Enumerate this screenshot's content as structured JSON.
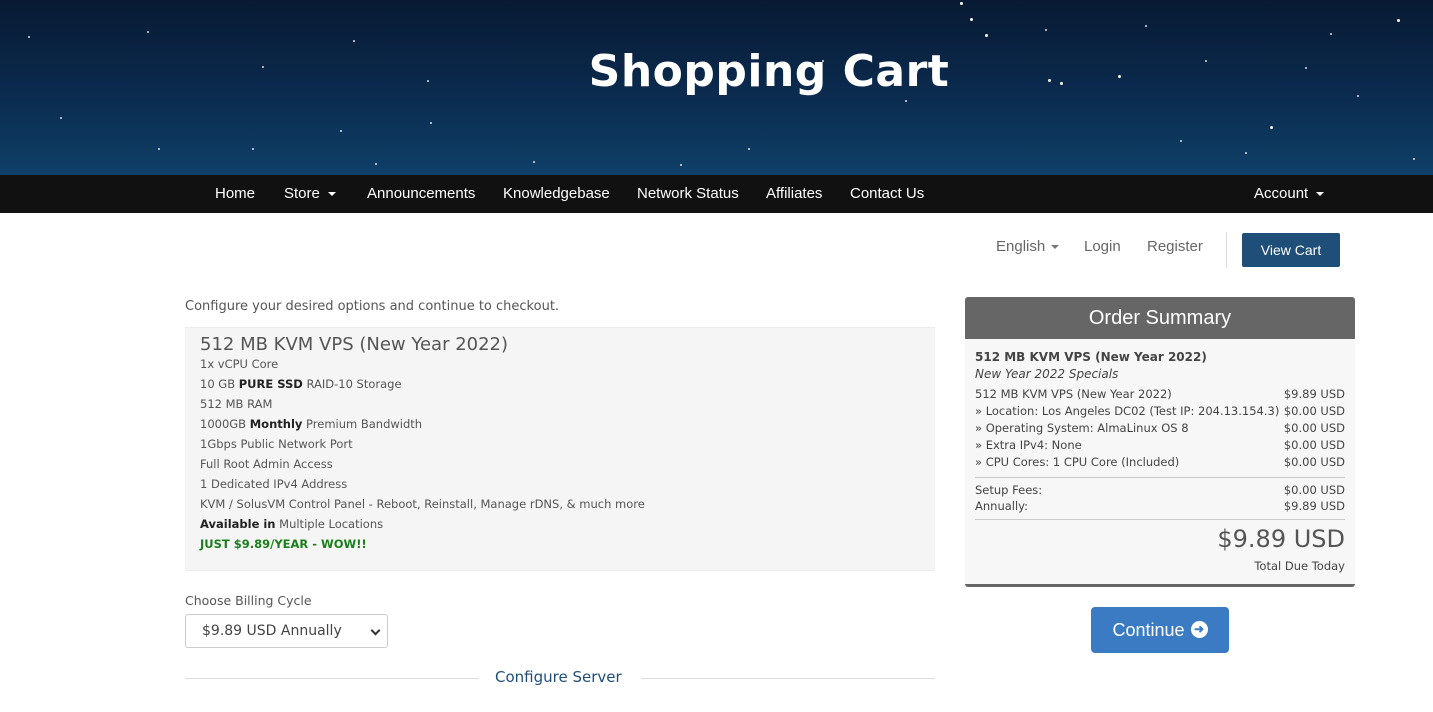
{
  "hero": {
    "title": "Shopping Cart"
  },
  "nav": {
    "home": "Home",
    "store": "Store",
    "announcements": "Announcements",
    "knowledgebase": "Knowledgebase",
    "network_status": "Network Status",
    "affiliates": "Affiliates",
    "contact": "Contact Us",
    "account": "Account"
  },
  "util": {
    "language": "English",
    "login": "Login",
    "register": "Register",
    "view_cart": "View Cart"
  },
  "main": {
    "intro": "Configure your desired options and continue to checkout.",
    "product": {
      "name": "512 MB KVM VPS (New Year 2022)",
      "features": [
        {
          "pre": "1x vCPU Core",
          "bold": "",
          "post": ""
        },
        {
          "pre": "10 GB ",
          "bold": "PURE SSD",
          "post": " RAID-10 Storage"
        },
        {
          "pre": "512 MB RAM",
          "bold": "",
          "post": ""
        },
        {
          "pre": "1000GB ",
          "bold": "Monthly",
          "post": " Premium Bandwidth"
        },
        {
          "pre": "1Gbps Public Network Port",
          "bold": "",
          "post": ""
        },
        {
          "pre": "Full Root Admin Access",
          "bold": "",
          "post": ""
        },
        {
          "pre": "1 Dedicated IPv4 Address",
          "bold": "",
          "post": ""
        },
        {
          "pre": "KVM / SolusVM Control Panel - Reboot, Reinstall, Manage rDNS, & much more",
          "bold": "",
          "post": ""
        },
        {
          "pre": "",
          "bold": "Available in",
          "post": " Multiple Locations"
        }
      ],
      "promo": "JUST $9.89/YEAR - WOW!!"
    },
    "billing": {
      "label": "Choose Billing Cycle",
      "selected": "$9.89 USD Annually"
    },
    "configure_title": "Configure Server"
  },
  "summary": {
    "title": "Order Summary",
    "product_name": "512 MB KVM VPS (New Year 2022)",
    "group": "New Year 2022 Specials",
    "lines": [
      {
        "label": "512 MB KVM VPS (New Year 2022)",
        "amount": "$9.89 USD"
      },
      {
        "label": "» Location: Los Angeles DC02 (Test IP: 204.13.154.3)",
        "amount": "$0.00 USD"
      },
      {
        "label": "» Operating System: AlmaLinux OS 8",
        "amount": "$0.00 USD"
      },
      {
        "label": "» Extra IPv4: None",
        "amount": "$0.00 USD"
      },
      {
        "label": "» CPU Cores: 1 CPU Core (Included)",
        "amount": "$0.00 USD"
      }
    ],
    "setup_fees_label": "Setup Fees:",
    "setup_fees": "$0.00 USD",
    "annually_label": "Annually:",
    "annually": "$9.89 USD",
    "total": "$9.89 USD",
    "total_label": "Total Due Today"
  },
  "continue_label": "Continue",
  "icons": {
    "continue": "arrow-circle-right-icon",
    "dropdown": "caret-down-icon"
  },
  "colors": {
    "primary": "#1f4e78",
    "continue": "#3a7bc4",
    "promo": "#1a7f1a",
    "summary_header": "#666666"
  }
}
